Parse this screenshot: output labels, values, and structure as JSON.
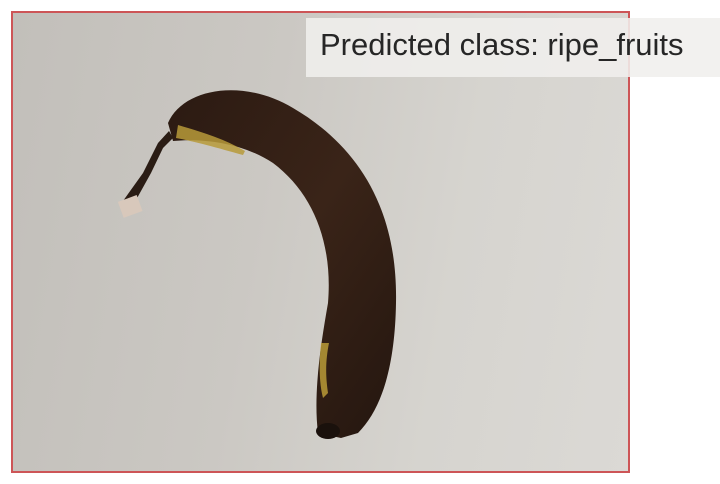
{
  "prediction": {
    "prefix": "Predicted class: ",
    "class_name": "ripe_fruits",
    "text": "Predicted class: ripe_fruits"
  },
  "colors": {
    "frame_border": "#cd5557",
    "label_text": "#262626"
  }
}
